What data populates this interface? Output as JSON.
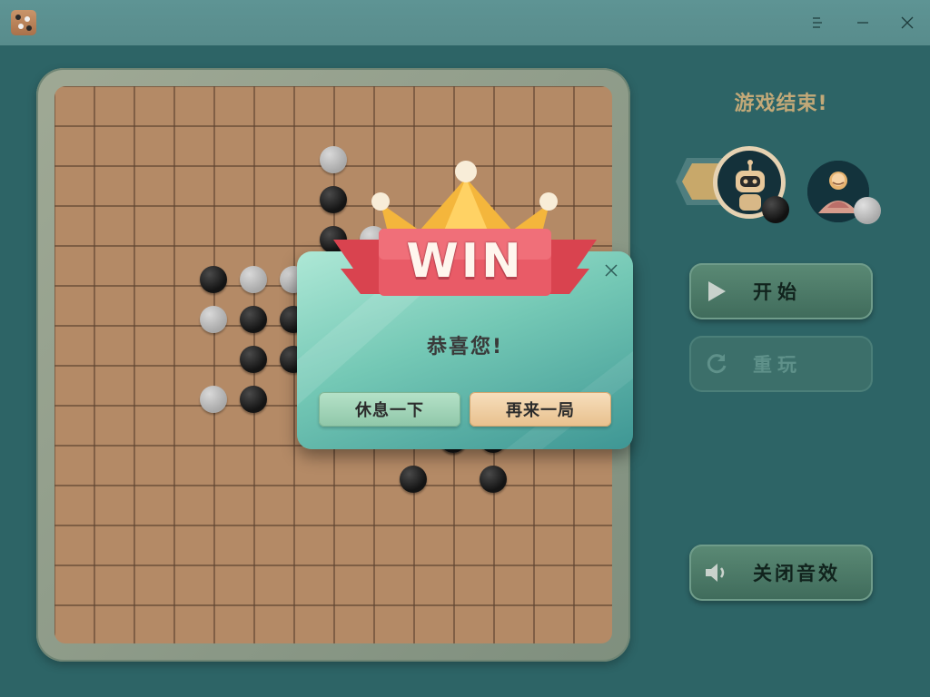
{
  "titlebar": {
    "app_icon": "dice-game-icon",
    "menu_icon": "menu-icon",
    "minimize_icon": "minimize-icon",
    "close_icon": "close-icon"
  },
  "game": {
    "status_text": "游戏结束!",
    "board_lines": 15,
    "black_stones": [
      [
        6,
        3
      ],
      [
        6,
        4
      ],
      [
        3,
        5
      ],
      [
        6,
        5
      ],
      [
        4,
        6
      ],
      [
        5,
        6
      ],
      [
        6,
        6
      ],
      [
        4,
        7
      ],
      [
        5,
        7
      ],
      [
        4,
        8
      ],
      [
        9,
        9
      ],
      [
        10,
        9
      ],
      [
        8,
        10
      ],
      [
        10,
        10
      ]
    ],
    "white_stones": [
      [
        6,
        2
      ],
      [
        7,
        4
      ],
      [
        4,
        5
      ],
      [
        5,
        5
      ],
      [
        3,
        6
      ],
      [
        6,
        7
      ],
      [
        3,
        8
      ],
      [
        6,
        8
      ],
      [
        9,
        9
      ]
    ],
    "players": {
      "ai_avatar": "robot-avatar",
      "ai_stone": "black",
      "user_avatar": "user-avatar",
      "user_stone": "white"
    }
  },
  "controls": {
    "start_label": "开始",
    "start_icon": "play-icon",
    "replay_label": "重玩",
    "replay_icon": "refresh-icon",
    "sound_label": "关闭音效",
    "sound_icon": "speaker-icon"
  },
  "dialog": {
    "banner": "WIN",
    "message": "恭喜您!",
    "rest_label": "休息一下",
    "again_label": "再来一局"
  },
  "colors": {
    "background": "#2d6466",
    "board": "#b48a66",
    "status": "#c2a978",
    "banner_red": "#e0525f"
  }
}
